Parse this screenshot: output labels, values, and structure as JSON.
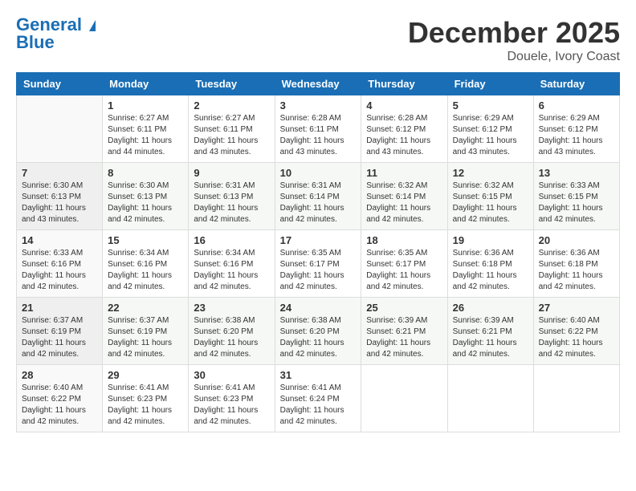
{
  "header": {
    "logo_general": "General",
    "logo_blue": "Blue",
    "month": "December 2025",
    "location": "Douele, Ivory Coast"
  },
  "weekdays": [
    "Sunday",
    "Monday",
    "Tuesday",
    "Wednesday",
    "Thursday",
    "Friday",
    "Saturday"
  ],
  "weeks": [
    [
      {
        "day": "",
        "info": ""
      },
      {
        "day": "1",
        "info": "Sunrise: 6:27 AM\nSunset: 6:11 PM\nDaylight: 11 hours\nand 44 minutes."
      },
      {
        "day": "2",
        "info": "Sunrise: 6:27 AM\nSunset: 6:11 PM\nDaylight: 11 hours\nand 43 minutes."
      },
      {
        "day": "3",
        "info": "Sunrise: 6:28 AM\nSunset: 6:11 PM\nDaylight: 11 hours\nand 43 minutes."
      },
      {
        "day": "4",
        "info": "Sunrise: 6:28 AM\nSunset: 6:12 PM\nDaylight: 11 hours\nand 43 minutes."
      },
      {
        "day": "5",
        "info": "Sunrise: 6:29 AM\nSunset: 6:12 PM\nDaylight: 11 hours\nand 43 minutes."
      },
      {
        "day": "6",
        "info": "Sunrise: 6:29 AM\nSunset: 6:12 PM\nDaylight: 11 hours\nand 43 minutes."
      }
    ],
    [
      {
        "day": "7",
        "info": "Sunrise: 6:30 AM\nSunset: 6:13 PM\nDaylight: 11 hours\nand 43 minutes."
      },
      {
        "day": "8",
        "info": "Sunrise: 6:30 AM\nSunset: 6:13 PM\nDaylight: 11 hours\nand 42 minutes."
      },
      {
        "day": "9",
        "info": "Sunrise: 6:31 AM\nSunset: 6:13 PM\nDaylight: 11 hours\nand 42 minutes."
      },
      {
        "day": "10",
        "info": "Sunrise: 6:31 AM\nSunset: 6:14 PM\nDaylight: 11 hours\nand 42 minutes."
      },
      {
        "day": "11",
        "info": "Sunrise: 6:32 AM\nSunset: 6:14 PM\nDaylight: 11 hours\nand 42 minutes."
      },
      {
        "day": "12",
        "info": "Sunrise: 6:32 AM\nSunset: 6:15 PM\nDaylight: 11 hours\nand 42 minutes."
      },
      {
        "day": "13",
        "info": "Sunrise: 6:33 AM\nSunset: 6:15 PM\nDaylight: 11 hours\nand 42 minutes."
      }
    ],
    [
      {
        "day": "14",
        "info": "Sunrise: 6:33 AM\nSunset: 6:16 PM\nDaylight: 11 hours\nand 42 minutes."
      },
      {
        "day": "15",
        "info": "Sunrise: 6:34 AM\nSunset: 6:16 PM\nDaylight: 11 hours\nand 42 minutes."
      },
      {
        "day": "16",
        "info": "Sunrise: 6:34 AM\nSunset: 6:16 PM\nDaylight: 11 hours\nand 42 minutes."
      },
      {
        "day": "17",
        "info": "Sunrise: 6:35 AM\nSunset: 6:17 PM\nDaylight: 11 hours\nand 42 minutes."
      },
      {
        "day": "18",
        "info": "Sunrise: 6:35 AM\nSunset: 6:17 PM\nDaylight: 11 hours\nand 42 minutes."
      },
      {
        "day": "19",
        "info": "Sunrise: 6:36 AM\nSunset: 6:18 PM\nDaylight: 11 hours\nand 42 minutes."
      },
      {
        "day": "20",
        "info": "Sunrise: 6:36 AM\nSunset: 6:18 PM\nDaylight: 11 hours\nand 42 minutes."
      }
    ],
    [
      {
        "day": "21",
        "info": "Sunrise: 6:37 AM\nSunset: 6:19 PM\nDaylight: 11 hours\nand 42 minutes."
      },
      {
        "day": "22",
        "info": "Sunrise: 6:37 AM\nSunset: 6:19 PM\nDaylight: 11 hours\nand 42 minutes."
      },
      {
        "day": "23",
        "info": "Sunrise: 6:38 AM\nSunset: 6:20 PM\nDaylight: 11 hours\nand 42 minutes."
      },
      {
        "day": "24",
        "info": "Sunrise: 6:38 AM\nSunset: 6:20 PM\nDaylight: 11 hours\nand 42 minutes."
      },
      {
        "day": "25",
        "info": "Sunrise: 6:39 AM\nSunset: 6:21 PM\nDaylight: 11 hours\nand 42 minutes."
      },
      {
        "day": "26",
        "info": "Sunrise: 6:39 AM\nSunset: 6:21 PM\nDaylight: 11 hours\nand 42 minutes."
      },
      {
        "day": "27",
        "info": "Sunrise: 6:40 AM\nSunset: 6:22 PM\nDaylight: 11 hours\nand 42 minutes."
      }
    ],
    [
      {
        "day": "28",
        "info": "Sunrise: 6:40 AM\nSunset: 6:22 PM\nDaylight: 11 hours\nand 42 minutes."
      },
      {
        "day": "29",
        "info": "Sunrise: 6:41 AM\nSunset: 6:23 PM\nDaylight: 11 hours\nand 42 minutes."
      },
      {
        "day": "30",
        "info": "Sunrise: 6:41 AM\nSunset: 6:23 PM\nDaylight: 11 hours\nand 42 minutes."
      },
      {
        "day": "31",
        "info": "Sunrise: 6:41 AM\nSunset: 6:24 PM\nDaylight: 11 hours\nand 42 minutes."
      },
      {
        "day": "",
        "info": ""
      },
      {
        "day": "",
        "info": ""
      },
      {
        "day": "",
        "info": ""
      }
    ]
  ]
}
